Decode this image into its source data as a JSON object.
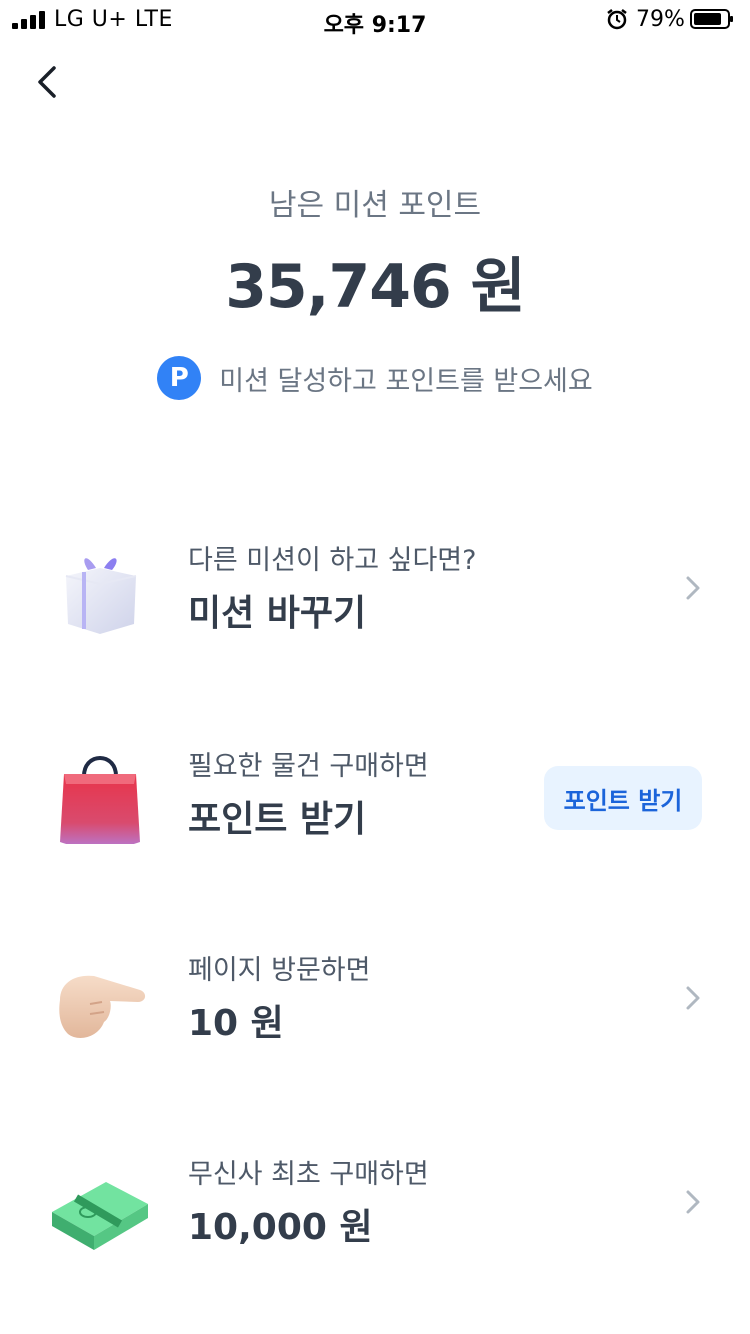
{
  "status_bar": {
    "carrier": "LG U+  LTE",
    "time": "오후 9:17",
    "battery": "79%"
  },
  "summary": {
    "label": "남은 미션 포인트",
    "value": "35,746 원"
  },
  "promo": {
    "badge": "P",
    "text": "미션 달성하고 포인트를 받으세요"
  },
  "missions": [
    {
      "subtitle": "다른 미션이 하고 싶다면?",
      "title": "미션 바꾸기",
      "icon": "gift-box-icon"
    },
    {
      "subtitle": "필요한 물건 구매하면",
      "title": "포인트 받기",
      "icon": "shopping-bag-icon",
      "button": "포인트 받기"
    },
    {
      "subtitle": "페이지 방문하면",
      "title": "10 원",
      "icon": "pointing-hand-icon"
    },
    {
      "subtitle": "무신사 최초 구매하면",
      "title": "10,000 원",
      "icon": "money-stack-icon"
    }
  ],
  "colors": {
    "accent": "#3182f6",
    "button_bg": "#e8f3ff",
    "button_text": "#1b64da",
    "text_primary": "#333d4b",
    "text_secondary": "#6b7684"
  }
}
